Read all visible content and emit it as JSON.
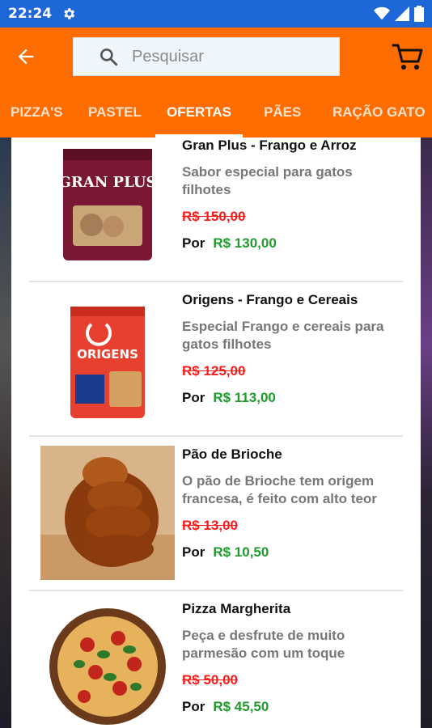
{
  "status": {
    "time": "22:24",
    "icons": [
      "gear-icon",
      "wifi-icon",
      "signal-icon",
      "battery-icon"
    ]
  },
  "appbar": {
    "back_icon": "arrow-back-icon",
    "search_placeholder": "Pesquisar",
    "search_value": "",
    "cart_icon": "cart-icon"
  },
  "tabs": [
    {
      "label": "PIZZA'S"
    },
    {
      "label": "PASTEL"
    },
    {
      "label": "OFERTAS"
    },
    {
      "label": "PÃES"
    },
    {
      "label": "RAÇÃO GATO"
    }
  ],
  "active_tab": "OFERTAS",
  "colors": {
    "primary": "#ff6d00",
    "status": "#1e67d8",
    "old_price": "#ff1a1a",
    "price": "#1f9b2b"
  },
  "products": [
    {
      "name": "Gran Plus - Frango e Arroz",
      "description": "Sabor especial para gatos filhotes",
      "old_price": "R$ 150,00",
      "por": "Por",
      "price": "R$ 130,00",
      "image_text": "GRAN PLUS"
    },
    {
      "name": "Origens - Frango e Cereais",
      "description": "Especial Frango e cereais para gatos filhotes",
      "old_price": "R$ 125,00",
      "por": "Por",
      "price": "R$ 113,00",
      "image_text": "ORIGENS"
    },
    {
      "name": "Pão de Brioche",
      "description": "O pão de Brioche tem origem francesa, é feito com alto teor",
      "old_price": "R$ 13,00",
      "por": "Por",
      "price": "R$ 10,50",
      "image_text": ""
    },
    {
      "name": "Pizza Margherita",
      "description": "Peça e desfrute de muito parmesão com um toque",
      "old_price": "R$ 50,00",
      "por": "Por",
      "price": "R$ 45,50",
      "image_text": ""
    }
  ]
}
